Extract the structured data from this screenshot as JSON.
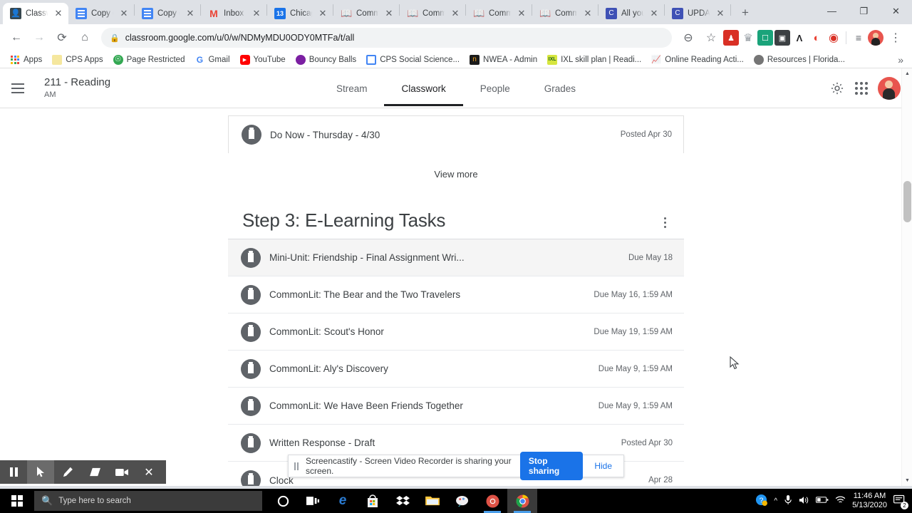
{
  "browser": {
    "tabs": [
      {
        "label": "Classw",
        "icon": "classroom-icon",
        "active": true
      },
      {
        "label": "Copy o",
        "icon": "google-docs-icon",
        "active": false
      },
      {
        "label": "Copy o",
        "icon": "google-docs-icon",
        "active": false
      },
      {
        "label": "Inbox",
        "icon": "gmail-icon",
        "active": false
      },
      {
        "label": "Chicag",
        "icon": "google-calendar-icon",
        "active": false
      },
      {
        "label": "Comm",
        "icon": "commonlit-book-icon",
        "active": false
      },
      {
        "label": "Comm",
        "icon": "commonlit-book-icon",
        "active": false
      },
      {
        "label": "Comm",
        "icon": "commonlit-book-icon",
        "active": false
      },
      {
        "label": "Comm",
        "icon": "commonlit-book-icon",
        "active": false
      },
      {
        "label": "All you",
        "icon": "commonlit-c-icon",
        "active": false
      },
      {
        "label": "UPDAT",
        "icon": "commonlit-c-icon",
        "active": false
      }
    ],
    "new_tab_label": "+",
    "window_controls": {
      "minimize": "—",
      "maximize": "❐",
      "close": "✕"
    },
    "nav": {
      "back": "←",
      "forward": "→",
      "reload": "⟳",
      "home": "⌂"
    },
    "omnibox": {
      "lock": "🔒",
      "url": "classroom.google.com/u/0/w/NDMyMDU0ODY0MTFa/t/all"
    },
    "toolbar_icons": [
      {
        "name": "zoom-out-icon",
        "glyph": "⊖"
      },
      {
        "name": "bookmark-star-icon",
        "glyph": "☆"
      }
    ],
    "extensions": [
      {
        "name": "extension-red-person-icon",
        "color": "#d93025",
        "glyph": "♥"
      },
      {
        "name": "ghostery-extension-icon",
        "color": "#9aa0a6",
        "glyph": "◉"
      },
      {
        "name": "extension-teal-note-icon",
        "color": "#1aa37a",
        "glyph": "■"
      },
      {
        "name": "extension-dark-square-icon",
        "color": "#3c4043",
        "glyph": "▣"
      },
      {
        "name": "extension-a-logo-icon",
        "color": "#202124",
        "glyph": "Λ"
      },
      {
        "name": "extension-orange-icon",
        "color": "#ea4335",
        "glyph": "◖"
      },
      {
        "name": "screencastify-extension-icon",
        "color": "#d93025",
        "glyph": "◉"
      }
    ],
    "reading_list_icon": "reading-list-icon",
    "menu_icon": "chrome-menu-icon",
    "bookmarks": [
      {
        "label": "Apps",
        "icon": "apps-grid-icon"
      },
      {
        "label": "CPS Apps",
        "icon": "cps-apps-icon"
      },
      {
        "label": "Page Restricted",
        "icon": "globe-icon"
      },
      {
        "label": "Gmail",
        "icon": "gmail-g-icon"
      },
      {
        "label": "YouTube",
        "icon": "youtube-icon"
      },
      {
        "label": "Bouncy Balls",
        "icon": "purple-circle-icon"
      },
      {
        "label": "CPS Social Science...",
        "icon": "blue-square-icon"
      },
      {
        "label": "NWEA - Admin",
        "icon": "nwea-icon"
      },
      {
        "label": "IXL skill plan | Readi...",
        "icon": "ixl-icon"
      },
      {
        "label": "Online Reading Acti...",
        "icon": "chart-icon"
      },
      {
        "label": "Resources | Florida...",
        "icon": "gray-circle-icon"
      }
    ],
    "bookmarks_overflow": "»"
  },
  "classroom": {
    "menu_icon": "hamburger-menu-icon",
    "course_name": "211 - Reading",
    "course_section": "AM",
    "tabs": [
      {
        "label": "Stream",
        "selected": false
      },
      {
        "label": "Classwork",
        "selected": true
      },
      {
        "label": "People",
        "selected": false
      },
      {
        "label": "Grades",
        "selected": false
      }
    ],
    "settings_icon": "gear-icon",
    "apps_icon": "google-apps-waffle-icon",
    "account_icon": "user-avatar",
    "top_item": {
      "title": "Do Now - Thursday - 4/30",
      "date": "Posted Apr 30"
    },
    "view_more": "View more",
    "topic": {
      "title": "Step 3: E-Learning Tasks",
      "menu_icon": "topic-kebab-menu-icon"
    },
    "assignments": [
      {
        "title": "Mini-Unit: Friendship - Final Assignment Wri...",
        "date": "Due May 18",
        "highlighted": true
      },
      {
        "title": "CommonLit: The Bear and the Two Travelers",
        "date": "Due May 16, 1:59 AM",
        "highlighted": false
      },
      {
        "title": "CommonLit: Scout's Honor",
        "date": "Due May 19, 1:59 AM",
        "highlighted": false
      },
      {
        "title": "CommonLit: Aly's Discovery",
        "date": "Due May 9, 1:59 AM",
        "highlighted": false
      },
      {
        "title": "CommonLit: We Have Been Friends Together",
        "date": "Due May 9, 1:59 AM",
        "highlighted": false
      },
      {
        "title": "Written Response - Draft",
        "date": "Posted Apr 30",
        "highlighted": false
      },
      {
        "title": "Clock",
        "date": "Apr 28",
        "highlighted": false
      }
    ]
  },
  "sharebar": {
    "pause_icon": "pause-bars-icon",
    "message": "Screencastify - Screen Video Recorder is sharing your screen.",
    "stop_label": "Stop sharing",
    "hide_label": "Hide"
  },
  "screencastify_toolbar": {
    "buttons": [
      {
        "name": "pause-recording-button",
        "glyph": "‖",
        "active": false
      },
      {
        "name": "cursor-tool-button",
        "glyph": "➤",
        "active": true
      },
      {
        "name": "pen-tool-button",
        "glyph": "✎",
        "active": false
      },
      {
        "name": "eraser-tool-button",
        "glyph": "▰",
        "active": false
      },
      {
        "name": "webcam-toggle-button",
        "glyph": "▶",
        "active": false
      },
      {
        "name": "close-toolbar-button",
        "glyph": "✕",
        "active": false
      }
    ]
  },
  "taskbar": {
    "start_icon": "windows-start-icon",
    "search_icon": "search-icon",
    "search_placeholder": "Type here to search",
    "cortana_icon": "cortana-circle-icon",
    "taskview_icon": "task-view-icon",
    "apps": [
      {
        "name": "edge-taskbar-icon",
        "glyph": "e",
        "color": "#2b7cd3",
        "state": ""
      },
      {
        "name": "microsoft-store-taskbar-icon",
        "glyph": "▣",
        "color": "#f3f3f3",
        "state": ""
      },
      {
        "name": "dropbox-taskbar-icon",
        "glyph": "❖",
        "color": "#ffffff",
        "state": ""
      },
      {
        "name": "file-explorer-taskbar-icon",
        "glyph": "⬛",
        "color": "#ffc83d",
        "state": ""
      },
      {
        "name": "paint3d-taskbar-icon",
        "glyph": "◔",
        "color": "#e8e8e8",
        "state": ""
      },
      {
        "name": "chrome-taskbar-icon",
        "glyph": "◉",
        "color": "#e8554e",
        "state": "open"
      },
      {
        "name": "chrome-active-taskbar-icon",
        "glyph": "◉",
        "color": "#4285f4",
        "state": "active"
      }
    ],
    "tray": [
      {
        "name": "help-tray-icon",
        "glyph": "?"
      },
      {
        "name": "show-hidden-icons-icon",
        "glyph": "∧"
      },
      {
        "name": "microphone-tray-icon",
        "glyph": "🎤"
      },
      {
        "name": "volume-tray-icon",
        "glyph": "🔊"
      },
      {
        "name": "battery-tray-icon",
        "glyph": "▭"
      },
      {
        "name": "wifi-tray-icon",
        "glyph": "◡"
      }
    ],
    "time": "11:46 AM",
    "date": "5/13/2020",
    "notification_icon": "action-center-icon",
    "notification_count": "2"
  }
}
